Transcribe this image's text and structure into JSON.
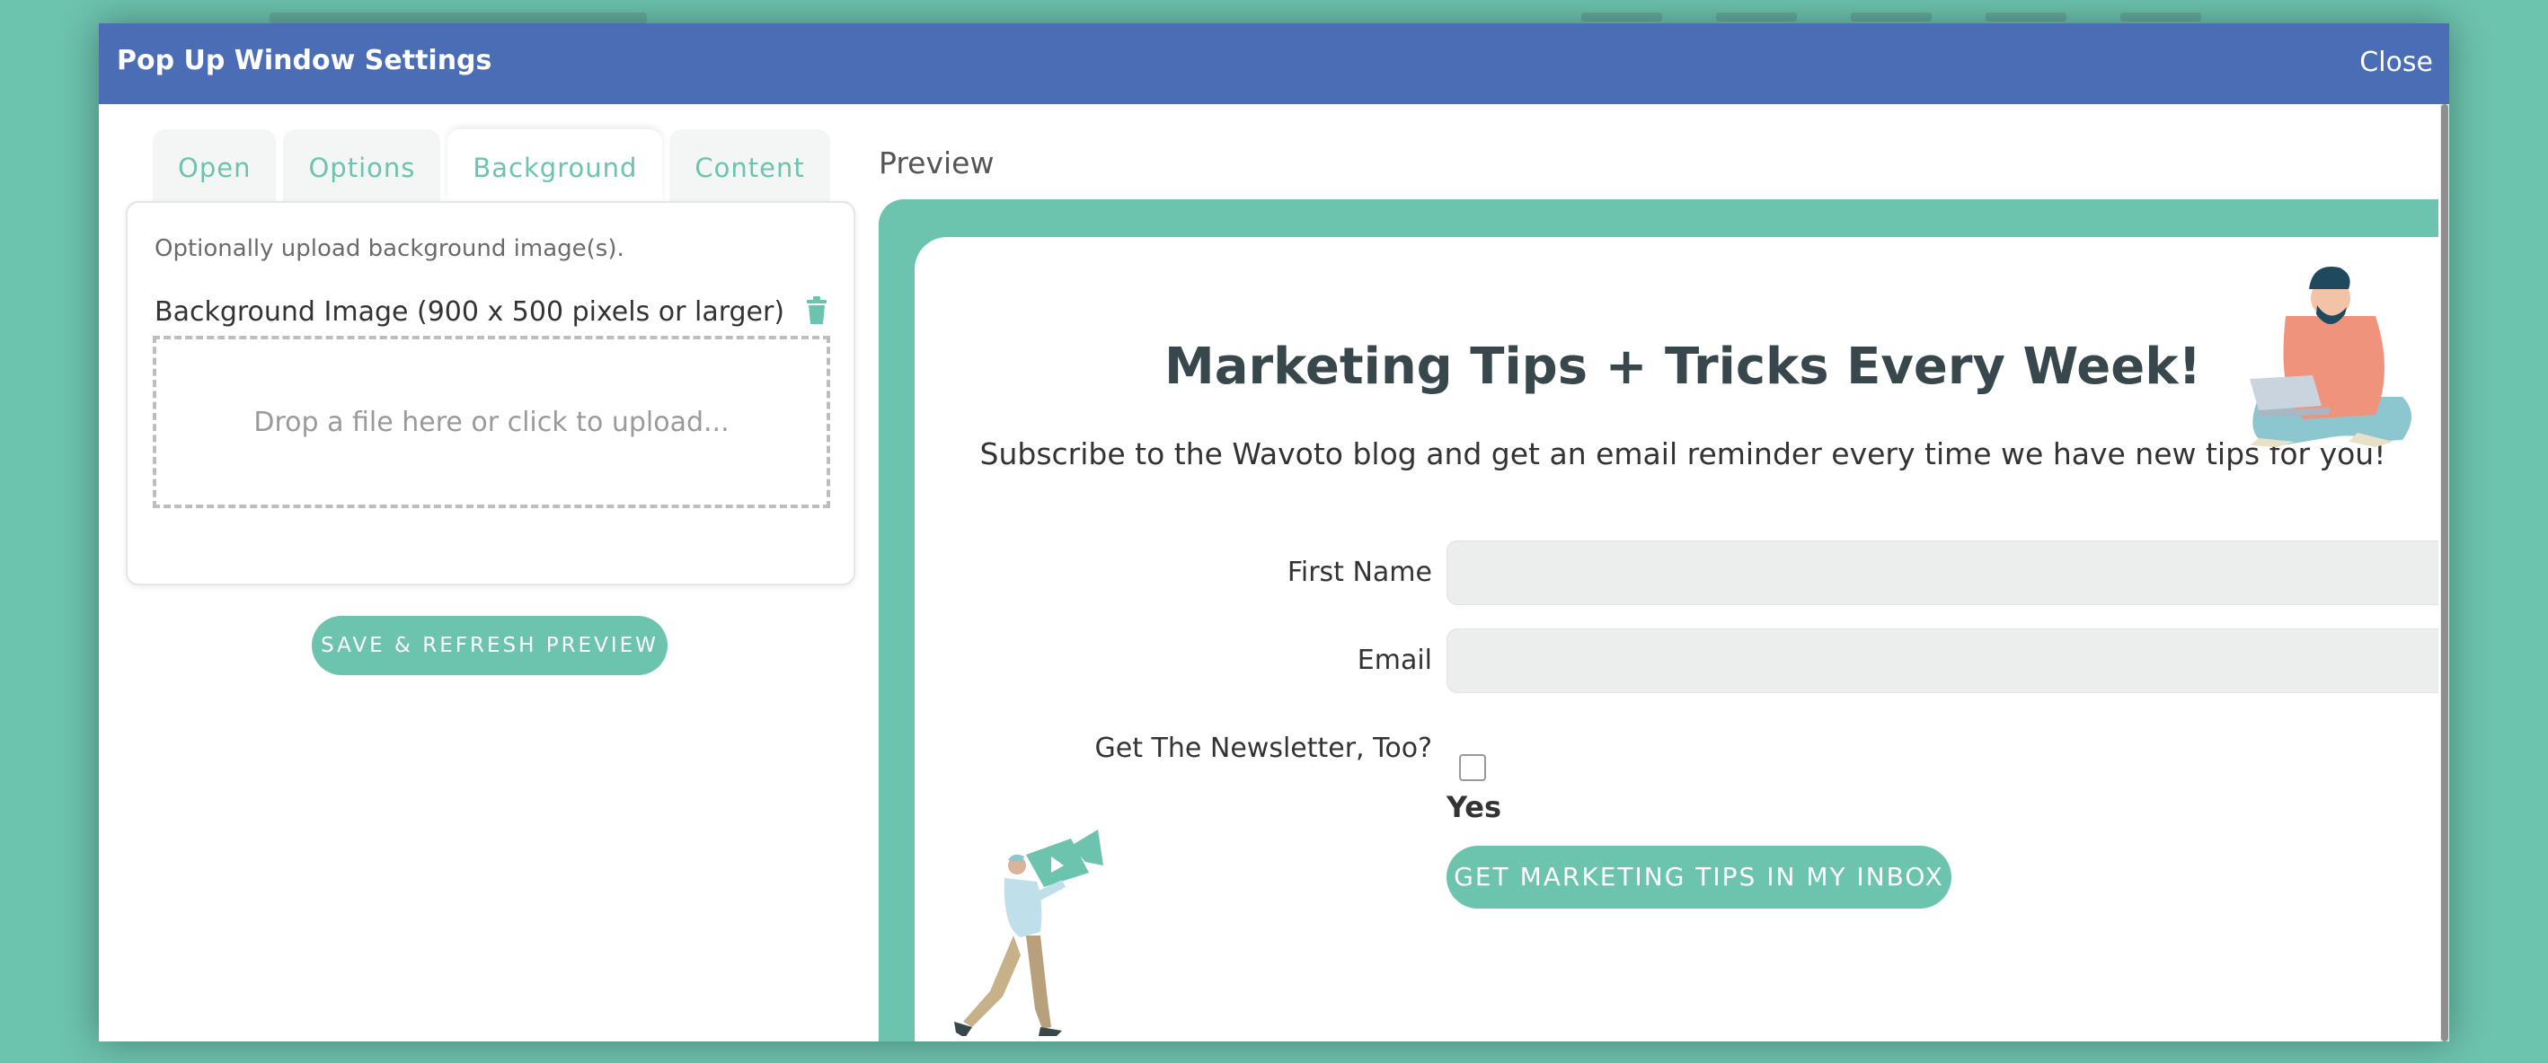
{
  "window": {
    "title": "Pop Up Window Settings",
    "close_label": "Close"
  },
  "tabs": [
    {
      "label": "Open",
      "active": false
    },
    {
      "label": "Options",
      "active": false
    },
    {
      "label": "Background",
      "active": true
    },
    {
      "label": "Content",
      "active": false
    }
  ],
  "background_panel": {
    "hint": "Optionally upload background image(s).",
    "image_label": "Background Image (900 x 500 pixels or larger)",
    "dropzone_text": "Drop a file here or click to upload..."
  },
  "save_button": "SAVE & REFRESH PREVIEW",
  "preview": {
    "label": "Preview",
    "headline": "Marketing Tips + Tricks Every Week!",
    "subtext": "Subscribe to the Wavoto blog and get an email reminder every time we have new tips for you!",
    "fields": {
      "first_name": "First Name",
      "email": "Email",
      "newsletter": "Get The Newsletter, Too?"
    },
    "checkbox_option": "Yes",
    "submit_label": "GET MARKETING TIPS IN MY INBOX"
  },
  "colors": {
    "accent": "#6cc3ae",
    "titlebar": "#4a6db5",
    "headline": "#37474b"
  }
}
